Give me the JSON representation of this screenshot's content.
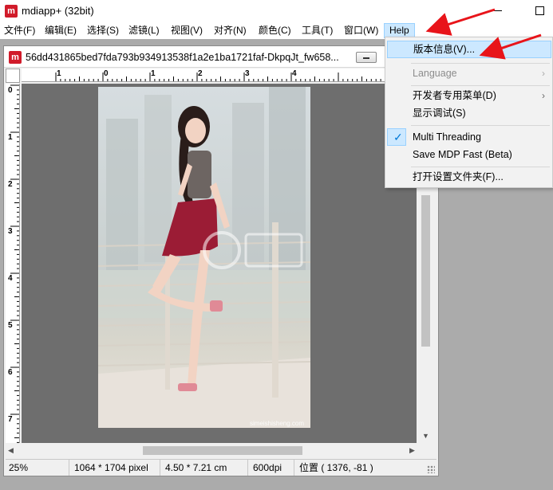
{
  "app": {
    "logo_letter": "m",
    "title": "mdiapp+ (32bit)"
  },
  "menubar": {
    "items": [
      {
        "label": "文件(F)"
      },
      {
        "label": "编辑(E)"
      },
      {
        "label": "选择(S)"
      },
      {
        "label": "滤镜(L)"
      },
      {
        "label": "视图(V)"
      },
      {
        "label": "对齐(N)"
      },
      {
        "label": "颜色(C)"
      },
      {
        "label": "工具(T)"
      },
      {
        "label": "窗口(W)"
      },
      {
        "label": "Help"
      }
    ]
  },
  "document": {
    "logo_letter": "m",
    "title": "56dd431865bed7fda793b934913538f1a2e1ba1721faf-DkpqJt_fw658...",
    "ruler_h": [
      "1",
      "0",
      "1",
      "2",
      "3",
      "4"
    ],
    "ruler_v": [
      "0",
      "1",
      "2",
      "3",
      "4",
      "5",
      "6",
      "7"
    ],
    "watermark": "simeishisheng.com"
  },
  "status": {
    "zoom": "25%",
    "pixel_size": "1064 * 1704 pixel",
    "physical_size": "4.50 * 7.21 cm",
    "dpi": "600dpi",
    "position": "位置 ( 1376, -81 )"
  },
  "help_menu": {
    "about": "版本信息(V)...",
    "language": "Language",
    "dev_menu": "开发者专用菜单(D)",
    "debug": "显示调试(S)",
    "multi_threading": "Multi Threading",
    "multi_threading_checked": true,
    "save_mdp_fast": "Save MDP Fast (Beta)",
    "open_settings": "打开设置文件夹(F)..."
  },
  "colors": {
    "brand_red": "#d11b2a",
    "highlight": "#cce8ff",
    "annotation_arrow": "#e8141a"
  }
}
